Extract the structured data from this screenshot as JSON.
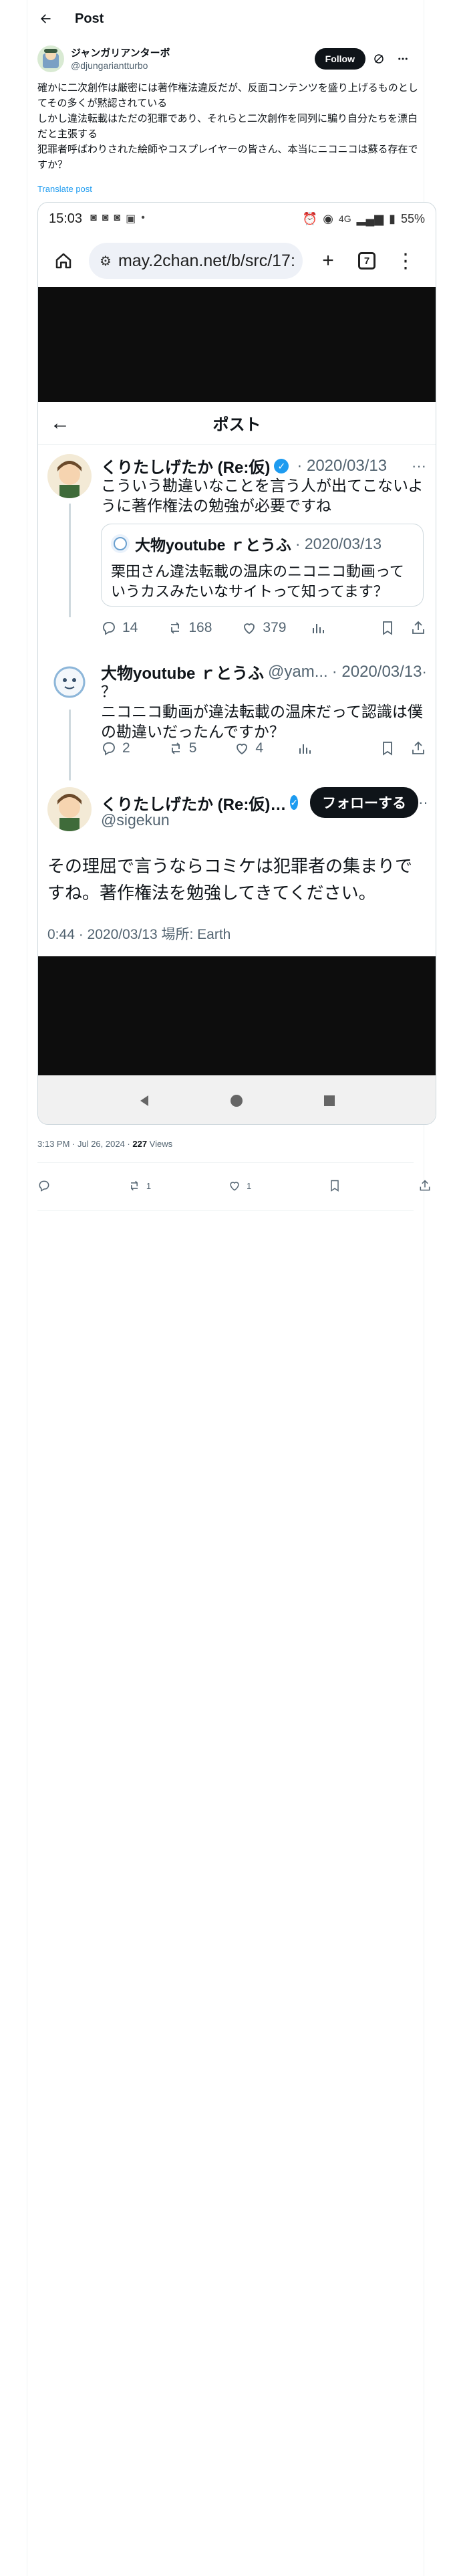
{
  "header": {
    "title": "Post"
  },
  "author": {
    "name": "ジャンガリアンターボ",
    "handle": "@djungariantturbo",
    "follow_label": "Follow"
  },
  "post": {
    "lines": [
      "確かに二次創作は厳密には著作権法違反だが、反面コンテンツを盛り上げるものとしてその多くが黙認されている",
      "しかし違法転載はただの犯罪であり、それらと二次創作を同列に騙り自分たちを漂白だと主張する",
      "犯罪者呼ばわりされた絵師やコスプレイヤーの皆さん、本当にニコニコは蘇る存在ですか？"
    ],
    "translate_label": "Translate post"
  },
  "screenshot": {
    "status": {
      "time": "15:03",
      "network": "4G",
      "battery": "55%"
    },
    "browser": {
      "url": "may.2chan.net/b/src/17:",
      "tabs": "7"
    },
    "page_title": "ポスト",
    "tweets": [
      {
        "name": "くりたしげたか (Re:仮)",
        "date": "· 2020/03/13",
        "body": "こういう勘違いなことを言う人が出てこないように著作権法の勉強が必要ですね",
        "quote": {
          "name": "大物youtube ｒとうふ",
          "date": "· 2020/03/13",
          "body": "栗田さん違法転載の温床のニコニコ動画っていうカスみたいなサイトって知ってます？"
        },
        "replies": "14",
        "reposts": "168",
        "likes": "379"
      },
      {
        "name": "大物youtube ｒとうふ",
        "handle": "@yam...",
        "date": "· 2020/03/13",
        "body": "？\nニコニコ動画が違法転載の温床だって認識は僕の勘違いだったんですか？",
        "replies": "2",
        "reposts": "5",
        "likes": "4"
      }
    ],
    "focus": {
      "name": "くりたしげたか (Re:仮)…",
      "handle": "@sigekun",
      "follow_label": "フォローする",
      "body": "その理屈で言うならコミケは犯罪者の集まりですね。著作権法を勉強してきてください。",
      "meta": "0:44 · 2020/03/13 場所: Earth"
    }
  },
  "post_meta": {
    "time": "3:13 PM · Jul 26, 2024 · ",
    "views": "227",
    "views_label": " Views"
  },
  "bottom_actions": {
    "reposts": "1",
    "likes": "1"
  }
}
